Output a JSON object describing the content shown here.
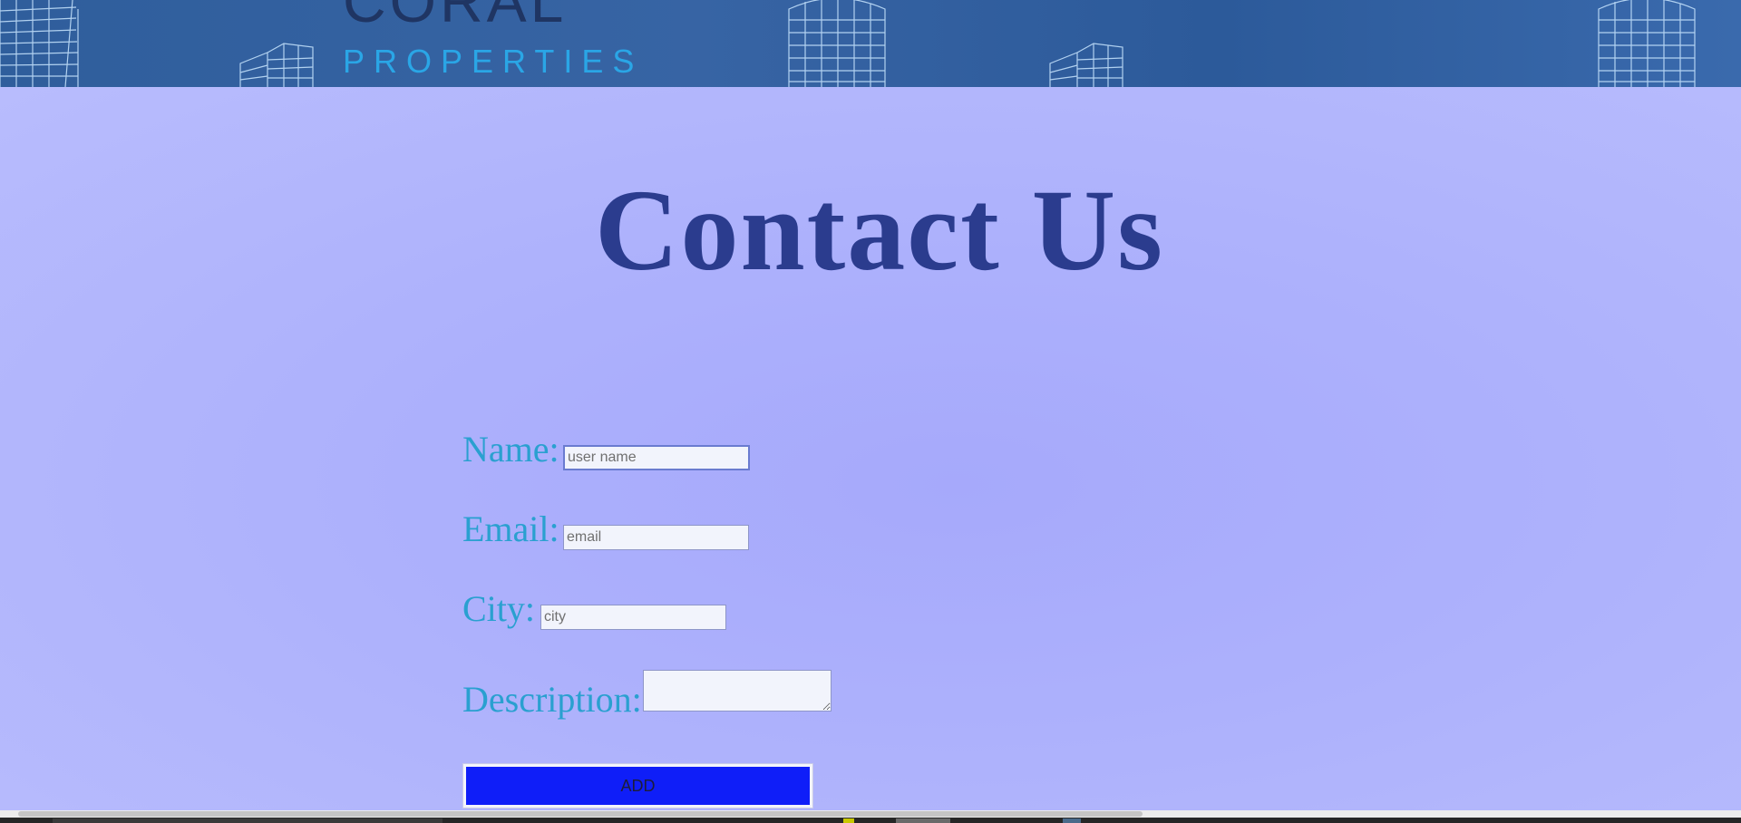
{
  "header": {
    "brand_top": "CORAL",
    "brand_bottom": "PROPERTIES"
  },
  "main": {
    "title": "Contact Us"
  },
  "form": {
    "name_label": "Name:",
    "name_placeholder": "user name",
    "name_value": "",
    "email_label": "Email:",
    "email_placeholder": "email",
    "email_value": "",
    "city_label": "City:",
    "city_placeholder": "city",
    "city_value": "",
    "description_label": "Description:",
    "description_value": "",
    "submit_label": "ADD"
  },
  "colors": {
    "banner": "#2f5e9c",
    "brand_top": "#1f3563",
    "brand_bottom": "#2aa6e6",
    "background": "#adb1fc",
    "title": "#2b3c8e",
    "labels": "#2aa0d0",
    "submit_button": "#0f1ef8"
  },
  "icons": {
    "building_graphic": "building-icon",
    "textarea_resize": "resize-handle-icon"
  }
}
